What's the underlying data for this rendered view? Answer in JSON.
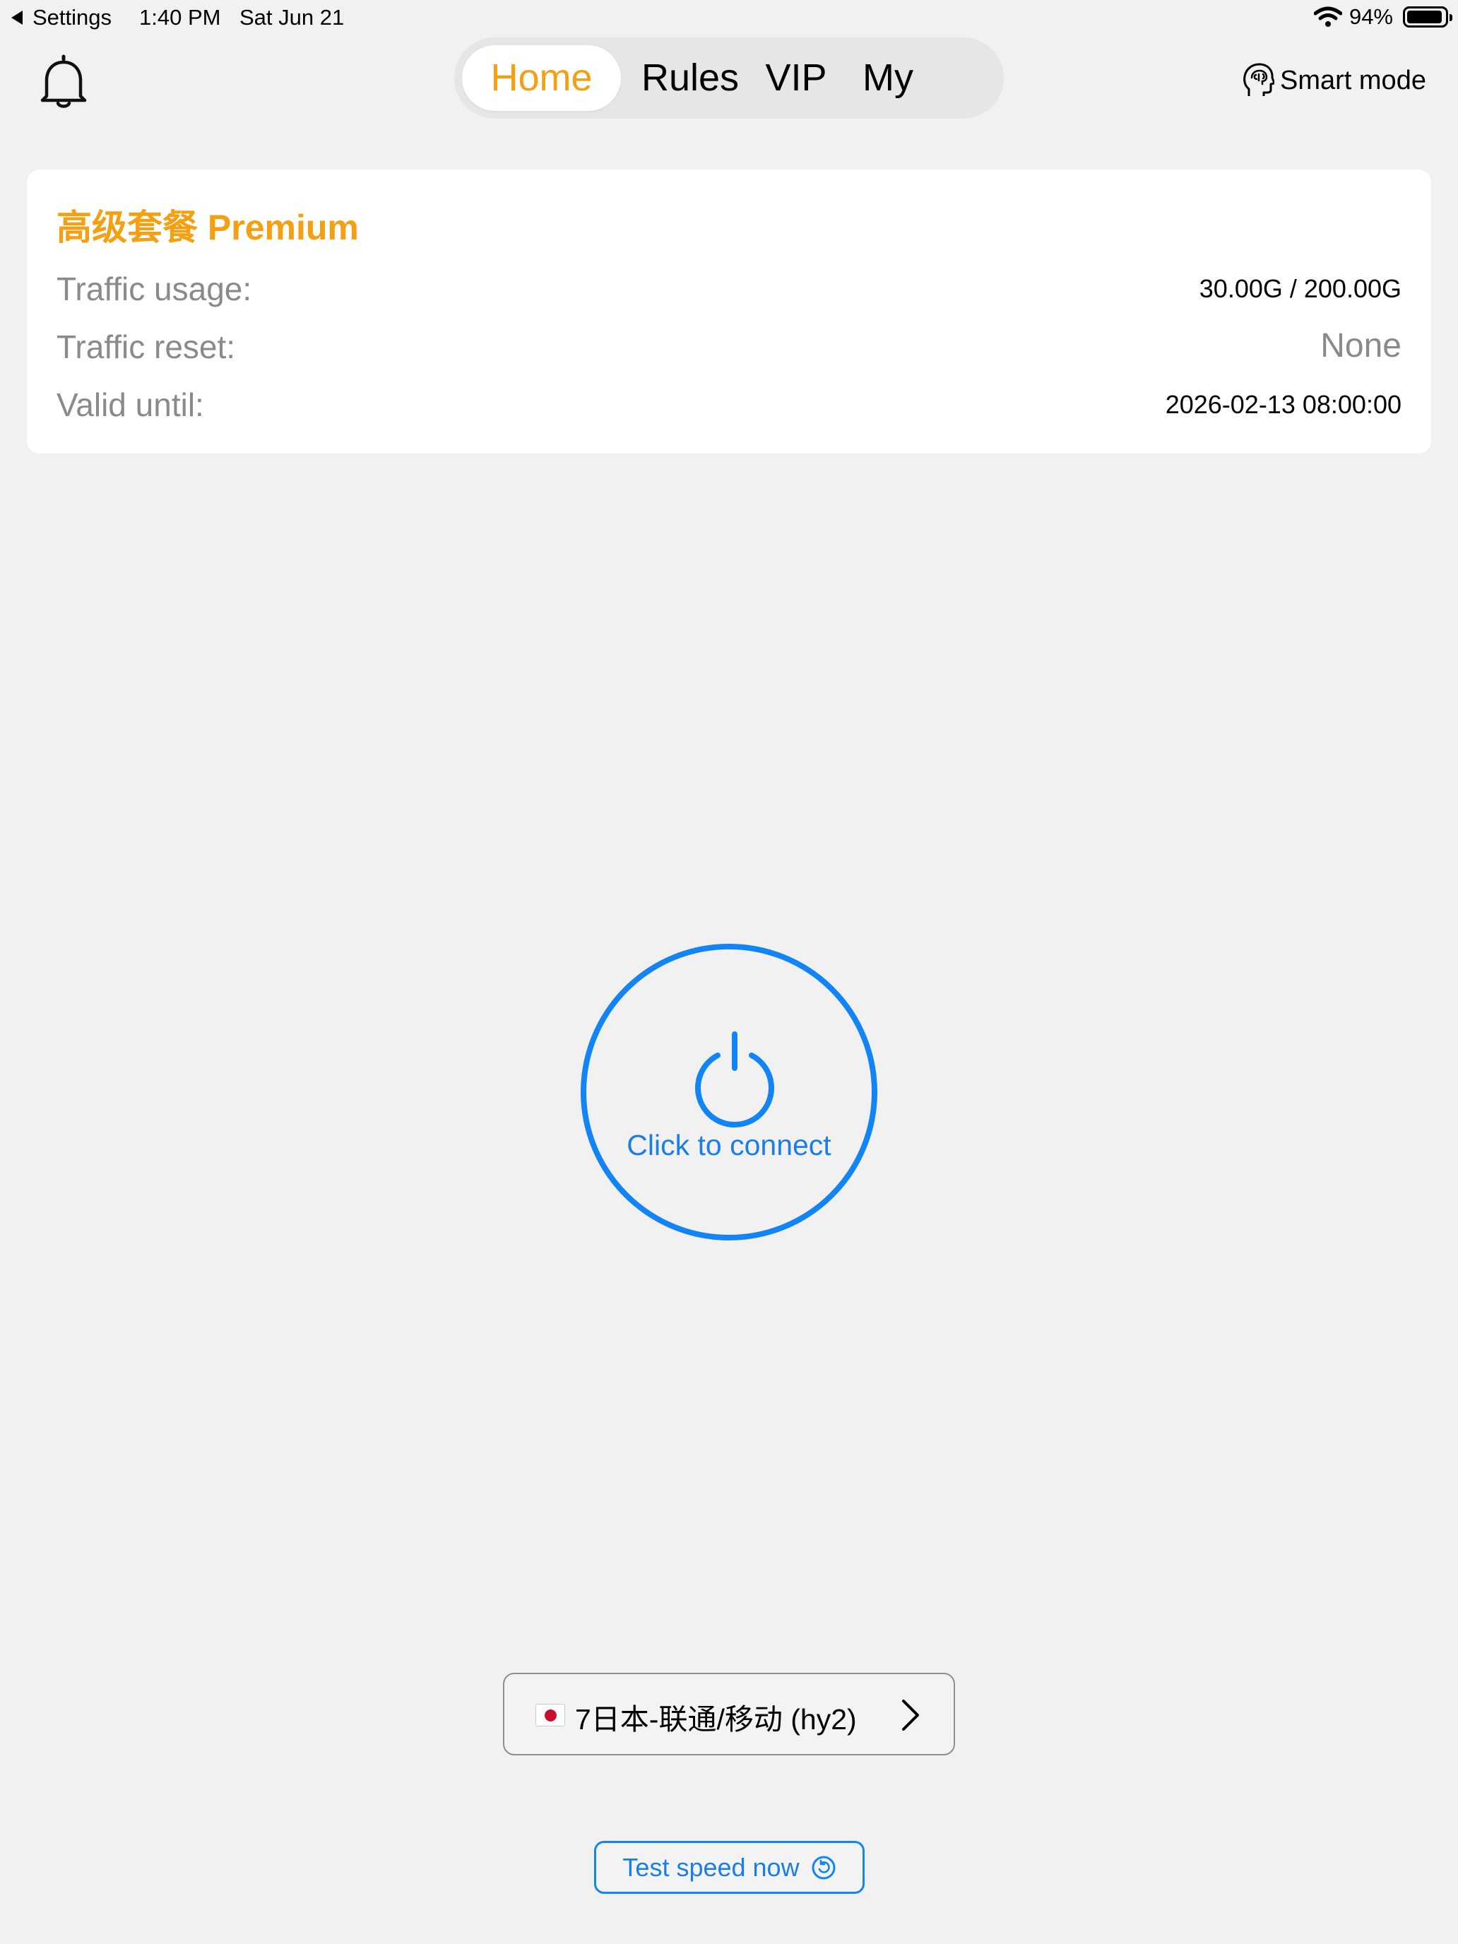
{
  "status_bar": {
    "back_label": "Settings",
    "time": "1:40 PM",
    "date": "Sat Jun 21",
    "battery_pct": "94%",
    "battery_level": 0.94
  },
  "header": {
    "tabs": [
      {
        "label": "Home",
        "active": true
      },
      {
        "label": "Rules",
        "active": false
      },
      {
        "label": "VIP",
        "active": false
      },
      {
        "label": "My",
        "active": false
      }
    ],
    "smart_mode_label": "Smart mode",
    "icons": {
      "bell": "bell-icon",
      "smart_mode": "brain-head-icon"
    }
  },
  "plan": {
    "title": "高级套餐 Premium",
    "rows": [
      {
        "label": "Traffic usage:",
        "value": "30.00G / 200.00G"
      },
      {
        "label": "Traffic reset:",
        "value": "None"
      },
      {
        "label": "Valid until:",
        "value": "2026-02-13 08:00:00"
      }
    ]
  },
  "connect": {
    "label": "Click to connect",
    "icon": "power-icon"
  },
  "server": {
    "flag": "japan-flag",
    "name": "7日本-联通/移动 (hy2)"
  },
  "speed_test": {
    "label": "Test speed now",
    "icon": "refresh-circle-icon"
  },
  "colors": {
    "accent_orange": "#f5a012",
    "accent_blue": "#1384f5",
    "background": "#f1f1f1",
    "muted_text": "#8a8a8e"
  }
}
